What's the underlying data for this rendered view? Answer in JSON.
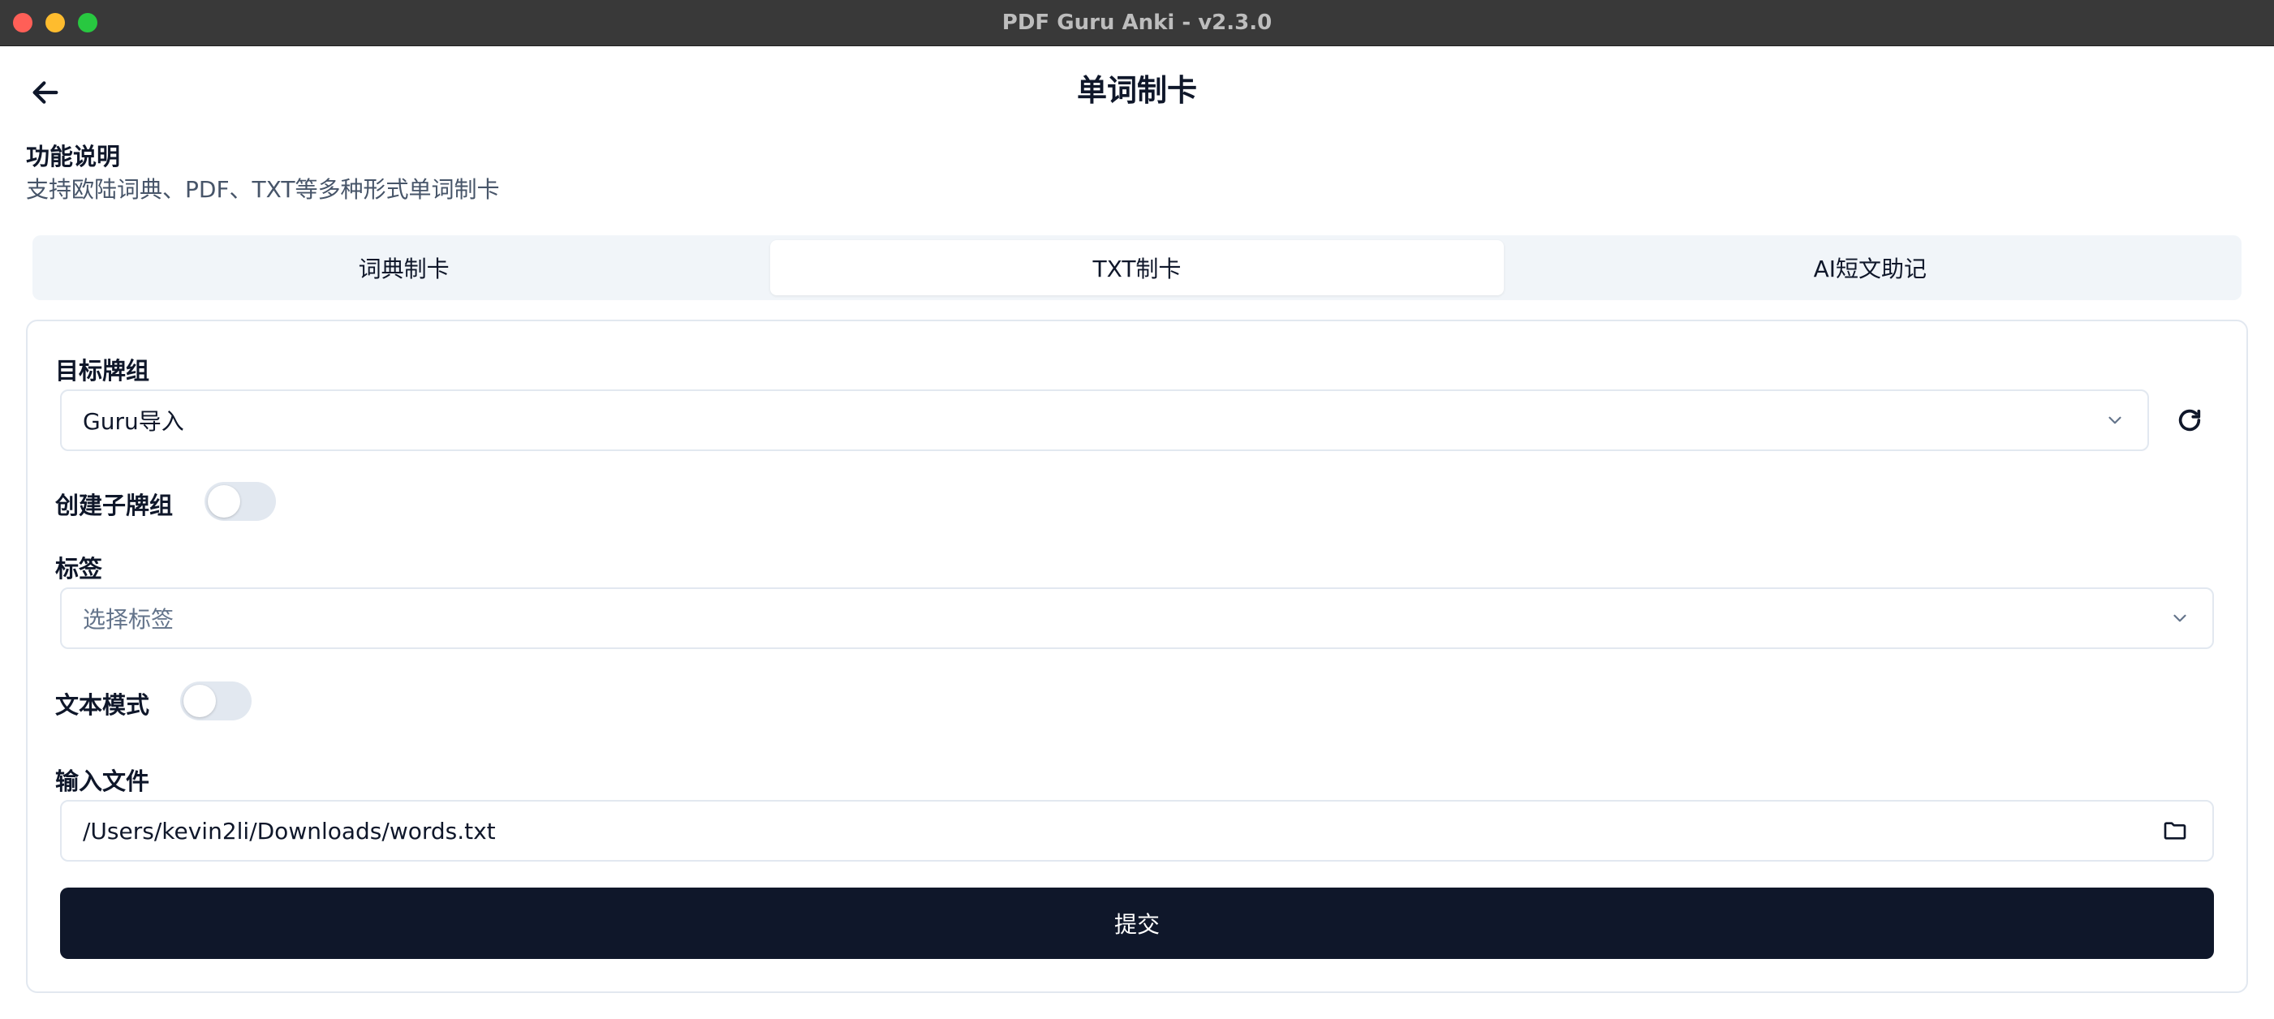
{
  "window": {
    "title": "PDF Guru Anki - v2.3.0"
  },
  "header": {
    "title": "单词制卡",
    "back_icon": "arrow-left-icon"
  },
  "description": {
    "title": "功能说明",
    "text": "支持欧陆词典、PDF、TXT等多种形式单词制卡"
  },
  "tabs": [
    {
      "label": "词典制卡",
      "active": false
    },
    {
      "label": "TXT制卡",
      "active": true
    },
    {
      "label": "AI短文助记",
      "active": false
    }
  ],
  "form": {
    "deck_label": "目标牌组",
    "deck_value": "Guru导入",
    "subdeck_label": "创建子牌组",
    "subdeck_on": false,
    "tags_label": "标签",
    "tags_placeholder": "选择标签",
    "text_mode_label": "文本模式",
    "text_mode_on": false,
    "file_label": "输入文件",
    "file_value": "/Users/kevin2li/Downloads/words.txt",
    "submit_label": "提交"
  },
  "colors": {
    "primary": "#0f172a",
    "muted": "#475569",
    "border": "#e2e8f0",
    "tab_bg": "#f1f5f9",
    "toggle_off": "#e2e8f0"
  }
}
